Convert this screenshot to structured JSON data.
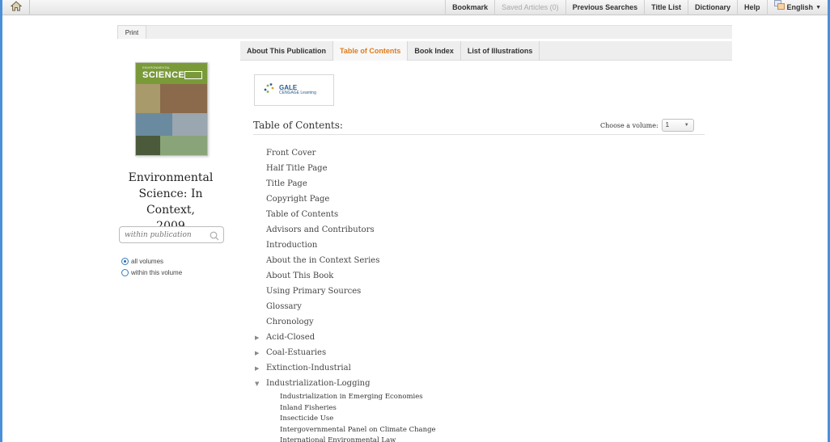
{
  "topbar": {
    "home_icon": "home-icon",
    "items": [
      {
        "label": "Bookmark",
        "disabled": false
      },
      {
        "label": "Saved Articles (0)",
        "disabled": true
      },
      {
        "label": "Previous Searches",
        "disabled": false
      },
      {
        "label": "Title List",
        "disabled": false
      },
      {
        "label": "Dictionary",
        "disabled": false
      },
      {
        "label": "Help",
        "disabled": false
      }
    ],
    "language": "English"
  },
  "print_label": "Print",
  "tabs": [
    {
      "label": "About This Publication",
      "active": false
    },
    {
      "label": "Table of Contents",
      "active": true
    },
    {
      "label": "Book Index",
      "active": false
    },
    {
      "label": "List of Illustrations",
      "active": false
    }
  ],
  "publication": {
    "cover_small": "ENVIRONMENTAL",
    "cover_big": "SCIENCE",
    "title_lines": [
      "Environmental",
      "Science: In Context,",
      "2009"
    ]
  },
  "search": {
    "placeholder": "within publication"
  },
  "scope": [
    {
      "label": "all volumes",
      "checked": true
    },
    {
      "label": "within this volume",
      "checked": false
    }
  ],
  "publisher": {
    "name": "GALE",
    "sub": "CENGAGE Learning"
  },
  "toc": {
    "title": "Table of Contents:",
    "volume_label": "Choose a volume:",
    "volume_value": "1",
    "front_matter": [
      "Front Cover",
      "Half Title Page",
      "Title Page",
      "Copyright Page",
      "Table of Contents",
      "Advisors and Contributors",
      "Introduction",
      "About the in Context Series",
      "About This Book",
      "Using Primary Sources",
      "Glossary",
      "Chronology"
    ],
    "sections": [
      {
        "label": "Acid-Closed",
        "expanded": false
      },
      {
        "label": "Coal-Estuaries",
        "expanded": false
      },
      {
        "label": "Extinction-Industrial",
        "expanded": false
      },
      {
        "label": "Industrialization-Logging",
        "expanded": true
      }
    ],
    "sub_items": [
      "Industrialization in Emerging Economies",
      "Inland Fisheries",
      "Insecticide Use",
      "Intergovernmental Panel on Climate Change",
      "International Environmental Law"
    ]
  },
  "colors": {
    "accent": "#e07b1a",
    "frame": "#4a90d9"
  }
}
